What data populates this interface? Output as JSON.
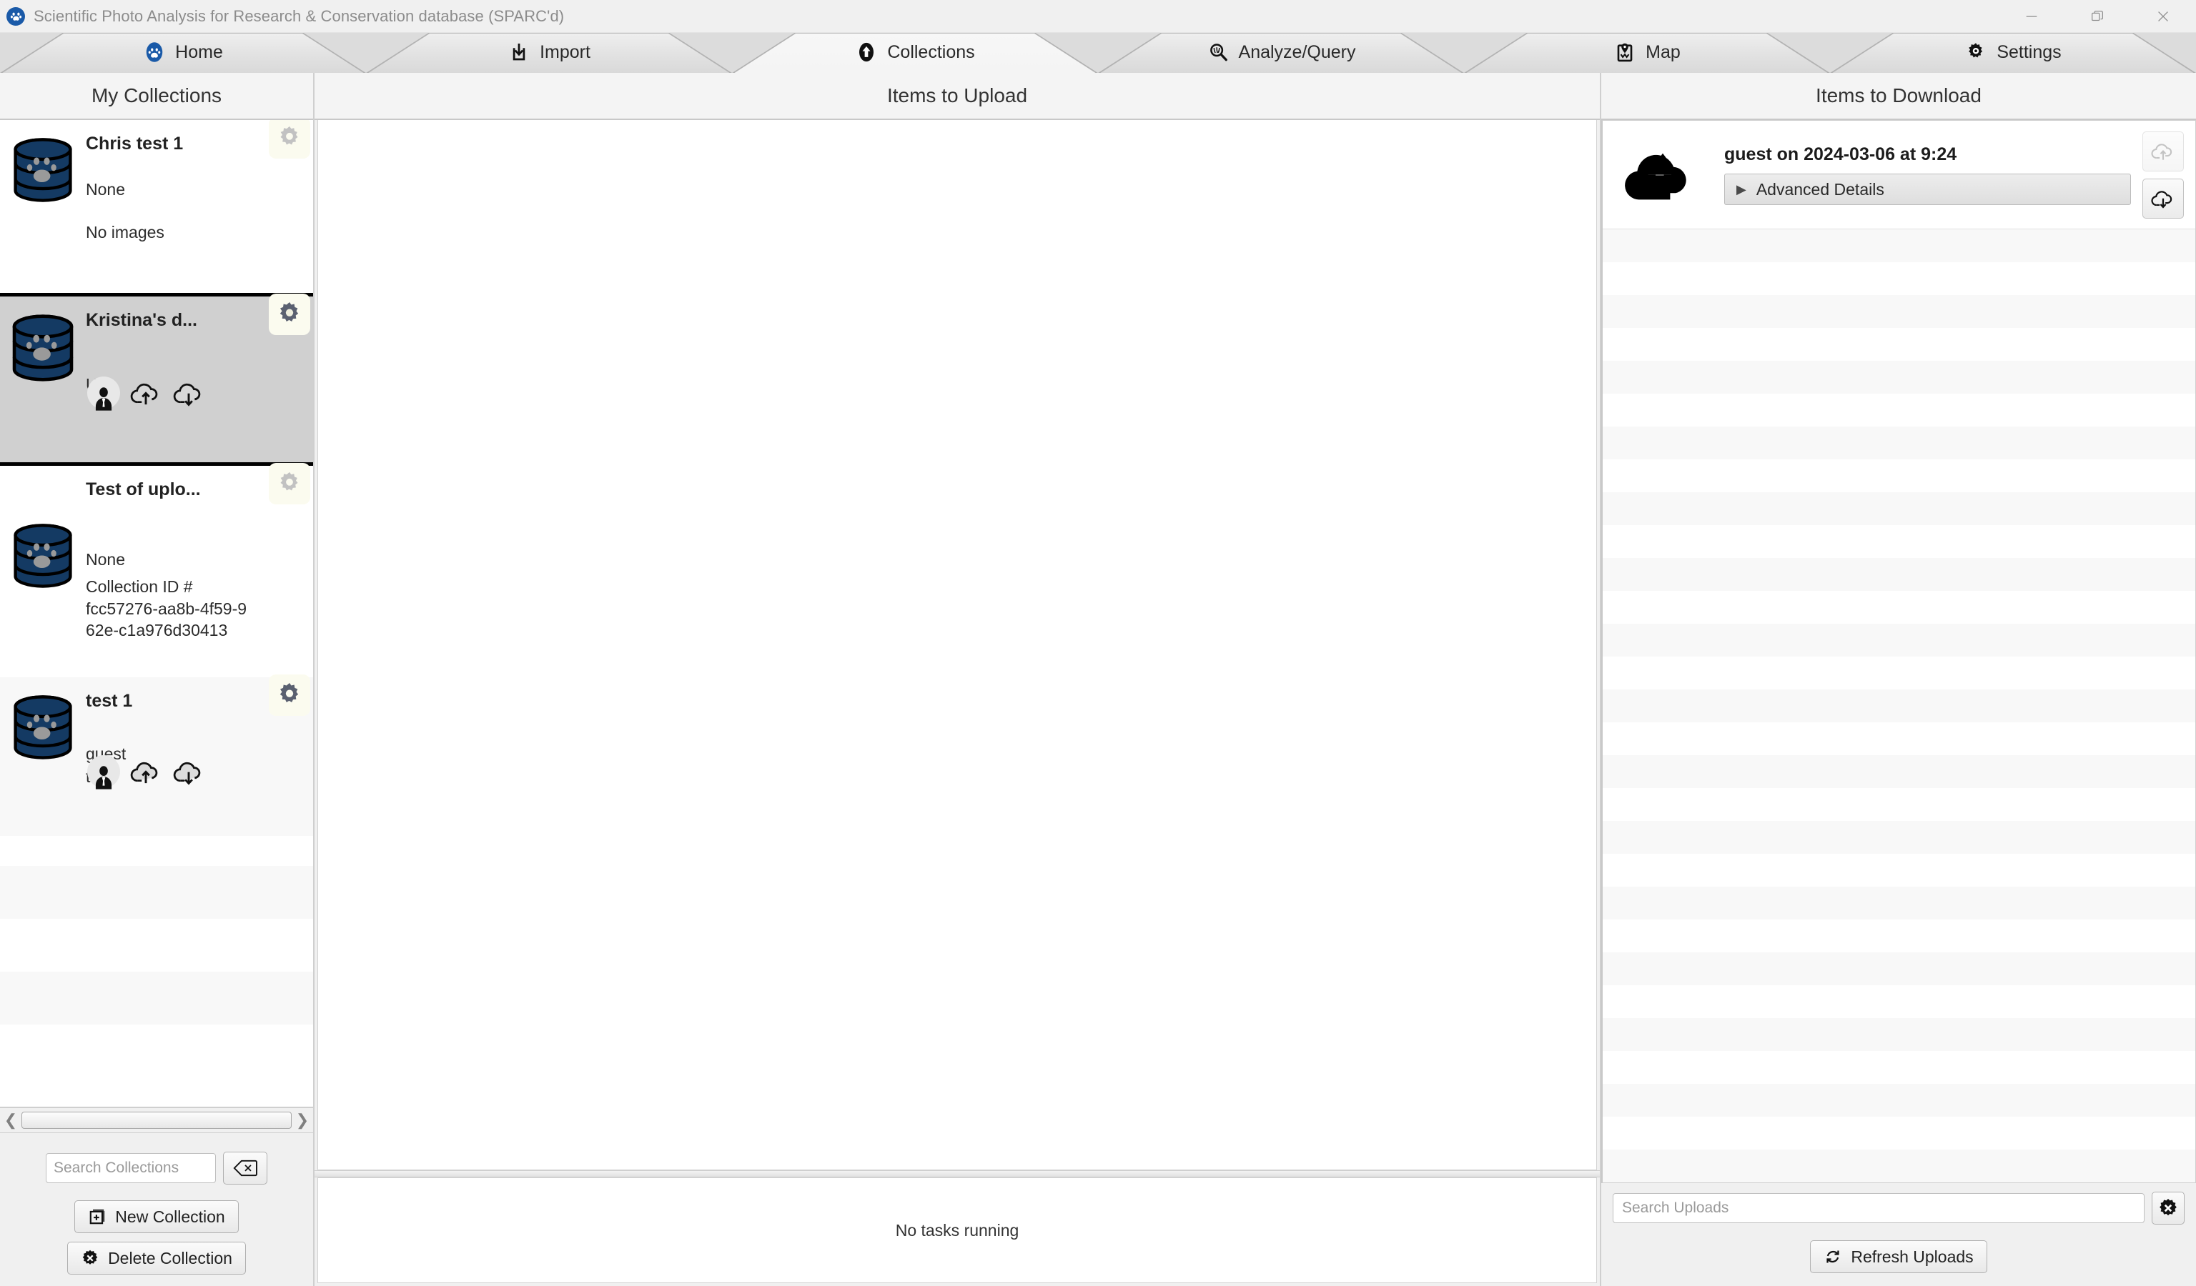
{
  "window": {
    "title": "Scientific Photo Analysis for Research & Conservation database (SPARC'd)",
    "logo_icon": "paw-print-icon",
    "controls": {
      "minimize": "minimize-icon",
      "restore": "restore-icon",
      "close": "close-icon"
    }
  },
  "tabs": [
    {
      "label": "Home",
      "icon": "paw-home-icon",
      "active": false
    },
    {
      "label": "Import",
      "icon": "import-icon",
      "active": false
    },
    {
      "label": "Collections",
      "icon": "collections-icon",
      "active": true
    },
    {
      "label": "Analyze/Query",
      "icon": "magnifier-icon",
      "active": false
    },
    {
      "label": "Map",
      "icon": "map-pin-icon",
      "active": false
    },
    {
      "label": "Settings",
      "icon": "gear-icon",
      "active": false
    }
  ],
  "left_panel": {
    "header": "My Collections",
    "collections": [
      {
        "name": "Chris test 1",
        "owner": "None",
        "detail": "No images",
        "detail2": "",
        "selected": false,
        "show_transfer_icons": false,
        "gear_icon": "gear-icon"
      },
      {
        "name": "Kristina's d...",
        "owner": "UA",
        "detail": "",
        "detail2": "",
        "selected": true,
        "show_transfer_icons": true,
        "gear_icon": "gear-icon"
      },
      {
        "name": "Test of uplo...",
        "owner": "None",
        "detail": "Collection ID #",
        "detail2": "fcc57276-aa8b-4f59-962e-c1a976d30413",
        "selected": false,
        "show_transfer_icons": false,
        "gear_icon": "gear-icon"
      },
      {
        "name": "test 1",
        "owner": "guest",
        "detail": "te",
        "detail2": "",
        "selected": false,
        "show_transfer_icons": true,
        "gear_icon": "gear-icon"
      }
    ],
    "search_placeholder": "Search Collections",
    "search_value": "",
    "clear_icon": "backspace-clear-icon",
    "new_collection_label": "New Collection",
    "new_collection_icon": "plus-square-icon",
    "delete_collection_label": "Delete Collection",
    "delete_collection_icon": "x-circle-icon"
  },
  "center_panel": {
    "header": "Items to Upload",
    "upload_items": [],
    "task_status": "No tasks running"
  },
  "right_panel": {
    "header": "Items to Download",
    "download_item": {
      "title": "guest on 2024-03-06 at 9:24",
      "advanced_label": "Advanced Details",
      "advanced_caret": "▶",
      "cloud_icon": "cloud-upload-solid-icon",
      "upload_button_icon": "cloud-upload-icon",
      "download_button_icon": "cloud-download-icon",
      "upload_button_enabled": false,
      "download_button_enabled": true
    },
    "search_placeholder": "Search Uploads",
    "search_value": "",
    "clear_icon": "x-circle-icon",
    "refresh_label": "Refresh Uploads",
    "refresh_icon": "refresh-icon"
  },
  "colors": {
    "brand_blue": "#1a5aa8",
    "db_body": "#143a63",
    "db_ring": "#8a8a8a",
    "selected_bg": "#d0d0d0",
    "gear_badge_bg": "#fbfbef",
    "panel_bg": "#f0f0f0"
  }
}
